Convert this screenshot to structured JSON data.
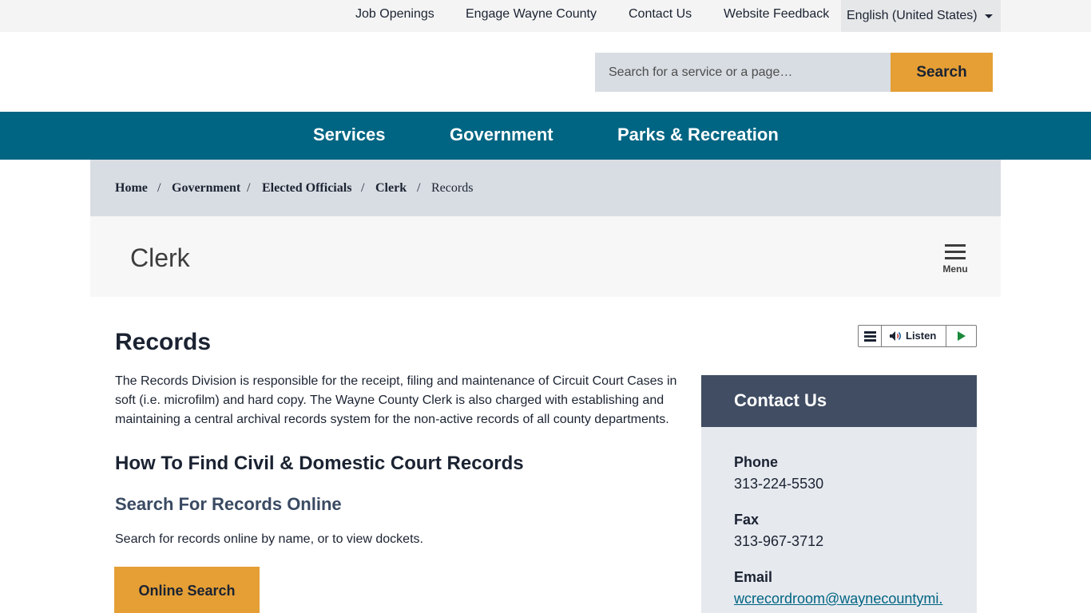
{
  "utility": {
    "links": [
      "Job Openings",
      "Engage Wayne County",
      "Contact Us",
      "Website Feedback"
    ],
    "language": "English (United States)"
  },
  "search": {
    "placeholder": "Search for a service or a page…",
    "button": "Search"
  },
  "nav": {
    "items": [
      "Services",
      "Government",
      "Parks & Recreation"
    ]
  },
  "breadcrumb": {
    "items": [
      "Home",
      "Government",
      "Elected Officials",
      "Clerk",
      "Records"
    ],
    "separator": "/"
  },
  "department": {
    "title": "Clerk",
    "menu_label": "Menu"
  },
  "listen": {
    "label": "Listen"
  },
  "content": {
    "title": "Records",
    "intro": "The Records Division is responsible for the receipt, filing and maintenance of Circuit Court Cases in soft (i.e. microfilm) and hard copy. The Wayne County Clerk is also charged with establishing and maintaining a central archival records system for the non-active records of all county departments.",
    "heading": "How To Find Civil & Domestic Court Records",
    "subheading": "Search For Records Online",
    "description": "Search for records online by name, or to view dockets.",
    "button": "Online Search"
  },
  "contact": {
    "title": "Contact Us",
    "phone_label": "Phone",
    "phone": "313-224-5530",
    "fax_label": "Fax",
    "fax": "313-967-3712",
    "email_label": "Email",
    "email": "wcrecordroom@waynecountymi."
  },
  "colors": {
    "nav": "#006583",
    "accent": "#e59f35",
    "sidebar_header": "#404d63",
    "sidebar_bg": "#e6e9ee",
    "breadcrumb_bg": "#d8dde3"
  },
  "icons": [
    "hamburger-menu-icon",
    "speaker-icon",
    "play-icon",
    "caret-down-icon"
  ]
}
